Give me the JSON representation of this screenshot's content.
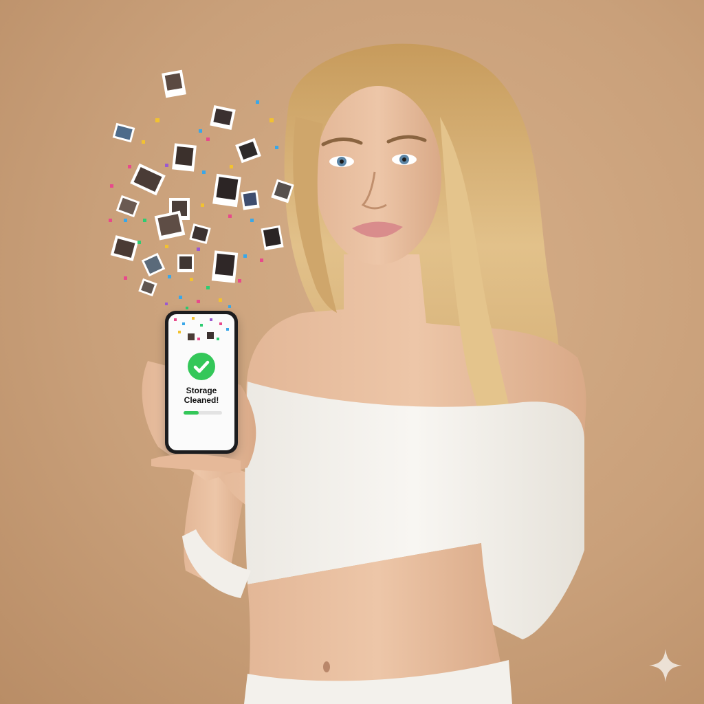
{
  "phone": {
    "status_line1": "Storage",
    "status_line2": "Cleaned!",
    "progress_fraction": 0.4
  },
  "colors": {
    "background": "#c9a07a",
    "check_green": "#34c759",
    "sweater": "#f4f2ee",
    "hair": "#d9b47a"
  },
  "icons": {
    "status": "check-circle-icon",
    "watermark": "sparkle-icon"
  }
}
